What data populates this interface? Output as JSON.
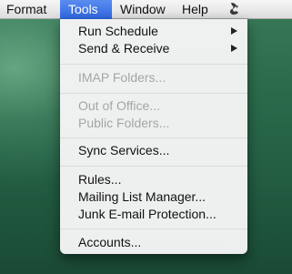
{
  "menubar": {
    "items": [
      {
        "label": "Format"
      },
      {
        "label": "Tools"
      },
      {
        "label": "Window"
      },
      {
        "label": "Help"
      }
    ],
    "script_icon": "script-icon",
    "active_item": "Tools",
    "highlight_color": "#3a72e8"
  },
  "tools_menu": {
    "items": [
      {
        "label": "Run Schedule",
        "submenu": true
      },
      {
        "label": "Send & Receive",
        "submenu": true
      },
      {
        "label": "IMAP Folders...",
        "disabled": true
      },
      {
        "label": "Out of Office...",
        "disabled": true
      },
      {
        "label": "Public Folders...",
        "disabled": true
      },
      {
        "label": "Sync Services..."
      },
      {
        "label": "Rules..."
      },
      {
        "label": "Mailing List Manager..."
      },
      {
        "label": "Junk E-mail Protection..."
      },
      {
        "label": "Accounts..."
      }
    ],
    "disabled_color": "#a5a5a5",
    "submenu_icon": "chevron-right-icon"
  }
}
